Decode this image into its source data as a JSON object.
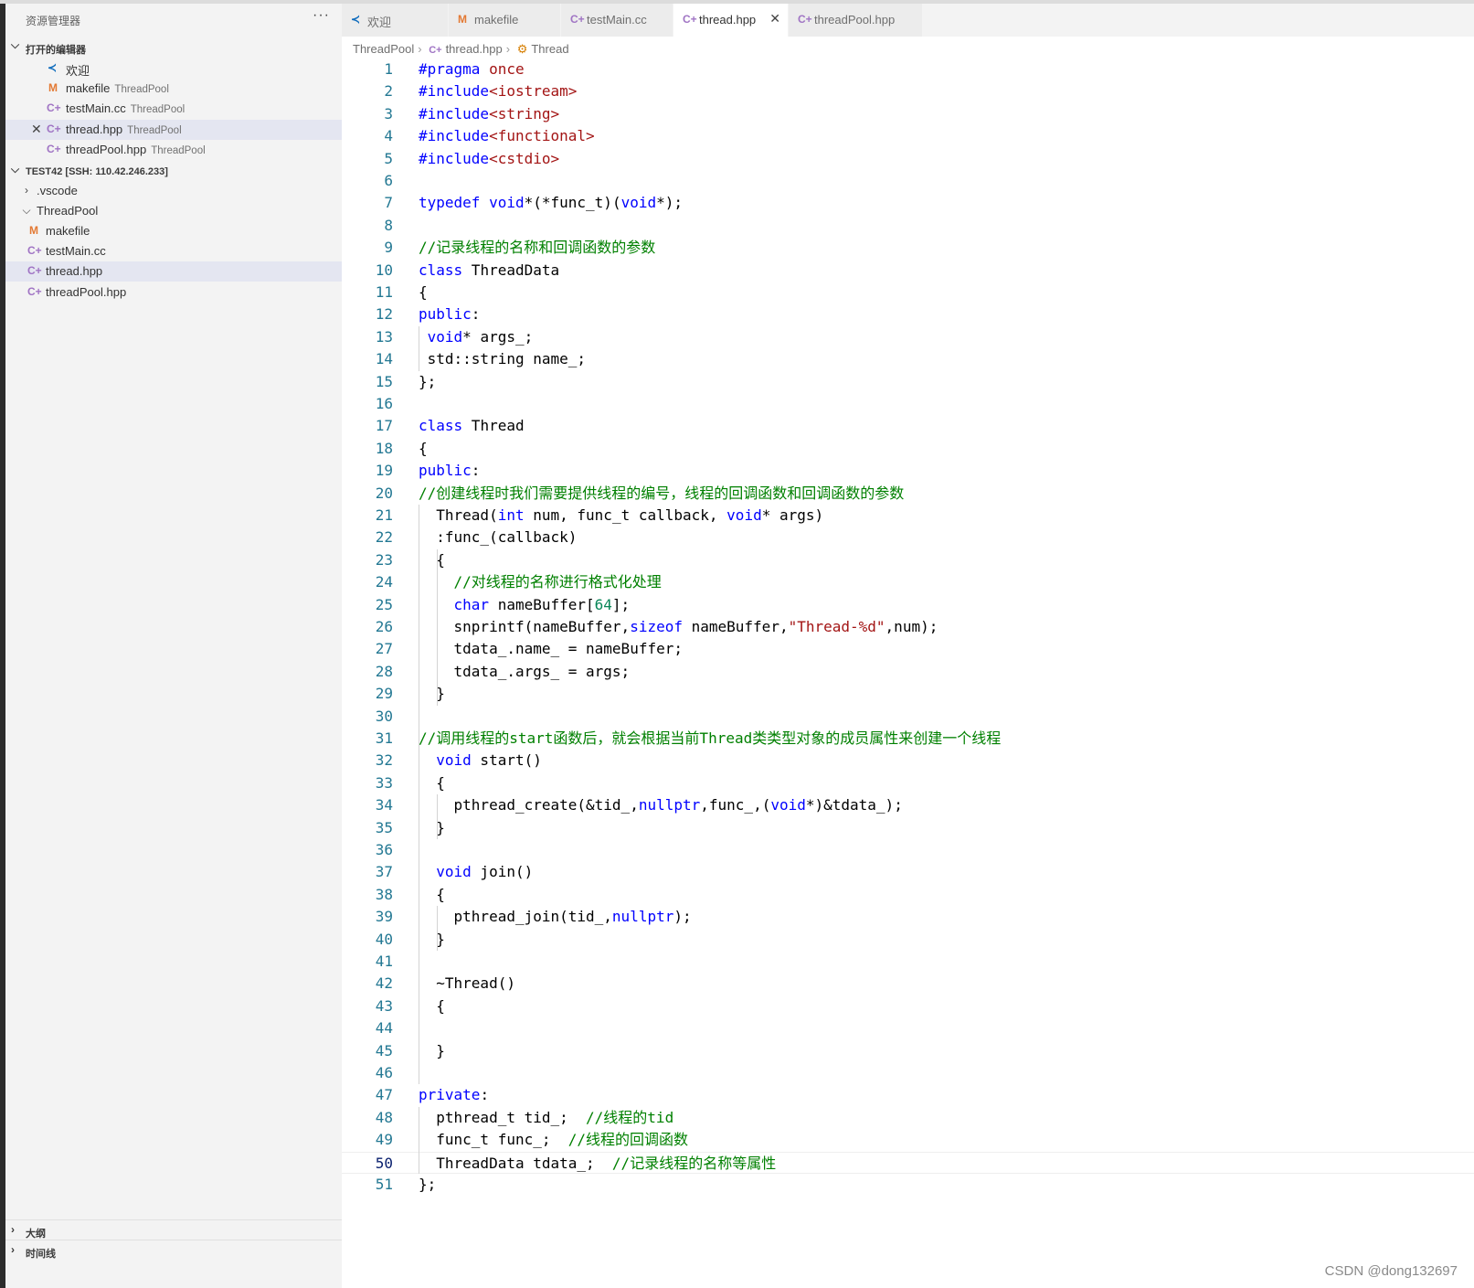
{
  "explorer": {
    "title": "资源管理器",
    "more": "···",
    "open_editors": {
      "label": "打开的编辑器",
      "items": [
        {
          "name": "欢迎",
          "desc": "",
          "icon": "vscode-icon"
        },
        {
          "name": "makefile",
          "desc": "ThreadPool",
          "icon": "M"
        },
        {
          "name": "testMain.cc",
          "desc": "ThreadPool",
          "icon": "C+"
        },
        {
          "name": "thread.hpp",
          "desc": "ThreadPool",
          "icon": "C+"
        },
        {
          "name": "threadPool.hpp",
          "desc": "ThreadPool",
          "icon": "C+"
        }
      ]
    },
    "workspace": {
      "label": "TEST42 [SSH: 110.42.246.233]",
      "vscode_folder": ".vscode",
      "threadpool_folder": "ThreadPool",
      "files": [
        "makefile",
        "testMain.cc",
        "thread.hpp",
        "threadPool.hpp"
      ]
    },
    "outline": "大纲",
    "timeline": "时间线"
  },
  "tabs": [
    "欢迎",
    "makefile",
    "testMain.cc",
    "thread.hpp",
    "threadPool.hpp"
  ],
  "breadcrumb": [
    "ThreadPool",
    "thread.hpp",
    "Thread"
  ],
  "line_numbers": [
    "1",
    "2",
    "3",
    "4",
    "5",
    "6",
    "7",
    "8",
    "9",
    "10",
    "11",
    "12",
    "13",
    "14",
    "15",
    "16",
    "17",
    "18",
    "19",
    "20",
    "21",
    "22",
    "23",
    "24",
    "25",
    "26",
    "27",
    "28",
    "29",
    "30",
    "31",
    "32",
    "33",
    "34",
    "35",
    "36",
    "37",
    "38",
    "39",
    "40",
    "41",
    "42",
    "43",
    "44",
    "45",
    "46",
    "47",
    "48",
    "49",
    "50",
    "51"
  ],
  "code_lines": [
    "#pragma once",
    "#include<iostream>",
    "#include<string>",
    "#include<functional>",
    "#include<cstdio>",
    "",
    "typedef void*(*func_t)(void*);",
    "",
    "//记录线程的名称和回调函数的参数",
    "class ThreadData",
    "{",
    "public:",
    " void* args_;",
    " std::string name_;",
    "};",
    "",
    "class Thread",
    "{",
    "public:",
    "//创建线程时我们需要提供线程的编号，线程的回调函数和回调函数的参数",
    "  Thread(int num, func_t callback, void* args)",
    "  :func_(callback)",
    "  {",
    "    //对线程的名称进行格式化处理",
    "    char nameBuffer[64];",
    "    snprintf(nameBuffer,sizeof nameBuffer,\"Thread-%d\",num);",
    "    tdata_.name_ = nameBuffer;",
    "    tdata_.args_ = args;",
    "  }",
    "",
    "//调用线程的start函数后，就会根据当前Thread类类型对象的成员属性来创建一个线程",
    "  void start()",
    "  {",
    "    pthread_create(&tid_,nullptr,func_,(void*)&tdata_);",
    "  }",
    "",
    "  void join()",
    "  {",
    "    pthread_join(tid_,nullptr);",
    "  }",
    "",
    "  ~Thread()",
    "  {",
    "",
    "  }",
    "",
    "private:",
    "  pthread_t tid_;  //线程的tid",
    "  func_t func_;  //线程的回调函数",
    "  ThreadData tdata_;  //记录线程的名称等属性",
    "};"
  ],
  "watermark": "CSDN @dong132697",
  "colors": {
    "keyword": "#0000ff",
    "preproc": "#0000ff",
    "comment": "#008000",
    "string": "#a31515",
    "number": "#098658",
    "linenumber": "#237893"
  }
}
